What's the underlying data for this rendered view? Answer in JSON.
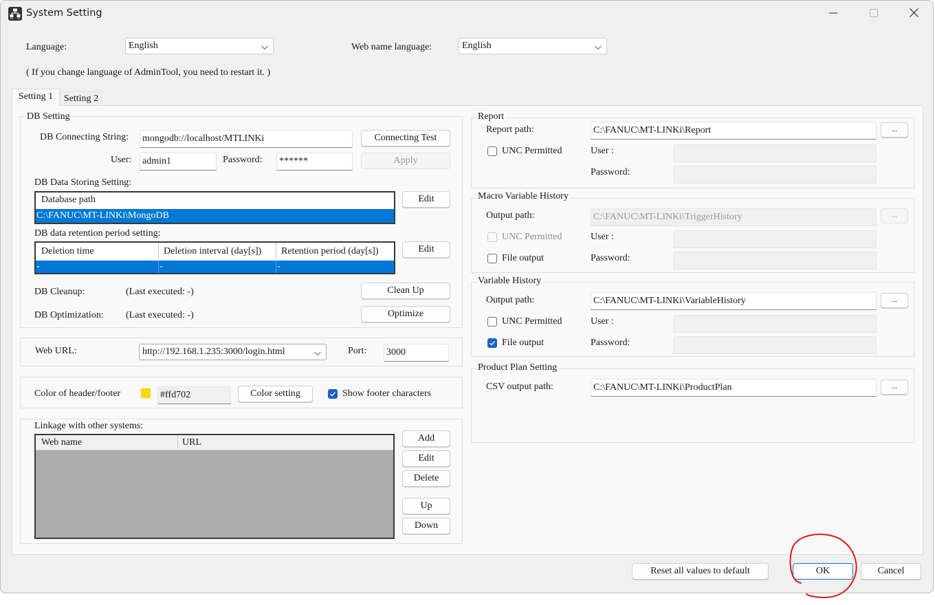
{
  "window": {
    "title": "System Setting",
    "icon": "network-settings-icon",
    "controls": {
      "minimize": "minimize-icon",
      "maximize": "maximize-icon",
      "close": "close-icon"
    }
  },
  "top": {
    "language_label": "Language:",
    "language_value": "English",
    "web_name_language_label": "Web name language:",
    "web_name_language_value": "English",
    "restart_note": "( If you change language of AdminTool, you need to restart it. )"
  },
  "tabs": [
    {
      "label": "Setting 1",
      "selected": true
    },
    {
      "label": "Setting 2",
      "selected": false
    }
  ],
  "db_setting": {
    "title": "DB Setting",
    "connecting_string_label": "DB Connecting String:",
    "connecting_string_value": "mongodb://localhost/MTLINKi",
    "connecting_test_button": "Connecting Test",
    "user_label": "User:",
    "user_value": "admin1",
    "password_label": "Password:",
    "password_value": "******",
    "apply_button": "Apply",
    "apply_enabled": false,
    "storing_label": "DB Data Storing Setting:",
    "storing_table": {
      "columns": [
        "Database path"
      ],
      "rows": [
        [
          "C:\\FANUC\\MT-LINKi\\MongoDB"
        ]
      ],
      "selected_row": 0
    },
    "storing_edit_button": "Edit",
    "retention_label": "DB data retention period setting:",
    "retention_table": {
      "columns": [
        "Deletion time",
        "Deletion interval (day[s])",
        "Retention period (day[s])"
      ],
      "rows": [
        [
          "-",
          "-",
          "-"
        ]
      ],
      "selected_row": 0
    },
    "retention_edit_button": "Edit",
    "cleanup_label": "DB Cleanup:",
    "cleanup_status": "(Last executed: -)",
    "cleanup_button": "Clean Up",
    "optimization_label": "DB Optimization:",
    "optimization_status": "(Last executed: -)",
    "optimize_button": "Optimize"
  },
  "web": {
    "url_label": "Web URL:",
    "url_value": "http://192.168.1.235:3000/login.html",
    "port_label": "Port:",
    "port_value": "3000"
  },
  "color": {
    "label": "Color of header/footer",
    "swatch_color": "#ffd702",
    "value": "#ffd702",
    "color_setting_button": "Color setting",
    "show_footer_label": "Show footer characters",
    "show_footer_checked": true
  },
  "linkage": {
    "label": "Linkage with other systems:",
    "columns": [
      "Web name",
      "URL"
    ],
    "rows": [],
    "buttons": {
      "add": "Add",
      "edit": "Edit",
      "delete": "Delete",
      "up": "Up",
      "down": "Down"
    }
  },
  "report": {
    "title": "Report",
    "path_label": "Report path:",
    "path_value": "C:\\FANUC\\MT-LINKi\\Report",
    "browse_button": "...",
    "unc_label": "UNC Permitted",
    "unc_checked": false,
    "user_label": "User :",
    "user_value": "",
    "password_label": "Password:",
    "password_value": ""
  },
  "macro_history": {
    "title": "Macro Variable History",
    "path_label": "Output path:",
    "path_value": "C:\\FANUC\\MT-LINKi\\TriggerHistory",
    "path_enabled": false,
    "browse_button": "...",
    "unc_label": "UNC Permitted",
    "unc_checked": false,
    "unc_enabled": false,
    "file_output_label": "File output",
    "file_output_checked": false,
    "user_label": "User :",
    "user_value": "",
    "password_label": "Password:",
    "password_value": ""
  },
  "variable_history": {
    "title": "Variable History",
    "path_label": "Output path:",
    "path_value": "C:\\FANUC\\MT-LINKi\\VariableHistory",
    "browse_button": "...",
    "unc_label": "UNC Permitted",
    "unc_checked": false,
    "file_output_label": "File output",
    "file_output_checked": true,
    "user_label": "User :",
    "user_value": "",
    "password_label": "Password:",
    "password_value": ""
  },
  "product_plan": {
    "title": "Product Plan Setting",
    "csv_label": "CSV output path:",
    "csv_value": "C:\\FANUC\\MT-LINKi\\ProductPlan",
    "browse_button": "..."
  },
  "footer": {
    "reset_button": "Reset all values to default",
    "ok_button": "OK",
    "cancel_button": "Cancel"
  },
  "annotation": {
    "type": "red-circle",
    "target": "ok_button",
    "color": "#e01818"
  }
}
